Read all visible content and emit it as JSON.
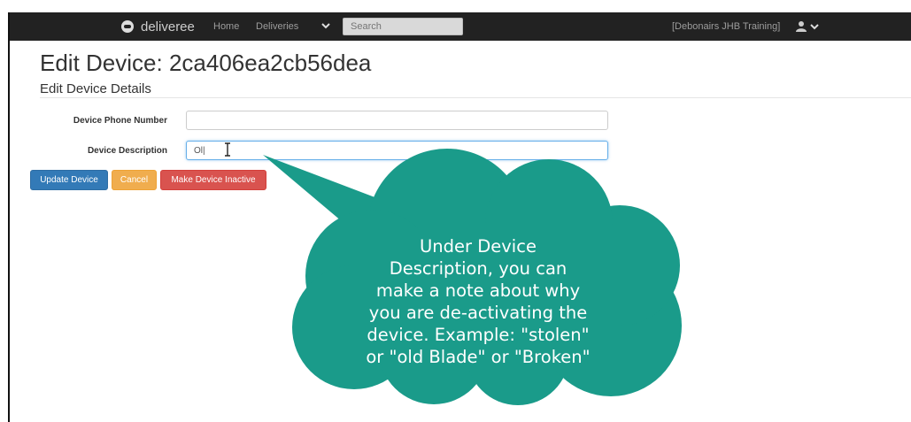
{
  "app": {
    "brand": "deliveree",
    "nav": {
      "home": "Home",
      "deliveries": "Deliveries"
    },
    "search_placeholder": "Search",
    "organization": "[Debonairs JHB Training]"
  },
  "page": {
    "title": "Edit Device: 2ca406ea2cb56dea",
    "section": "Edit Device Details"
  },
  "form": {
    "phone_label": "Device Phone Number",
    "phone_value": "",
    "description_label": "Device Description",
    "description_value": "Ol|"
  },
  "buttons": {
    "update": "Update Device",
    "cancel": "Cancel",
    "inactive": "Make Device Inactive"
  },
  "callout": {
    "lines": [
      "Under Device",
      "Description, you can",
      "make a note about why",
      "you are de-activating the",
      "device. Example: \"stolen\"",
      "or \"old Blade\" or \"Broken\""
    ],
    "color": "#1a9b8a"
  },
  "icons": [
    "car-logo-icon",
    "chevron-down-icon",
    "user-icon",
    "text-cursor-icon"
  ]
}
